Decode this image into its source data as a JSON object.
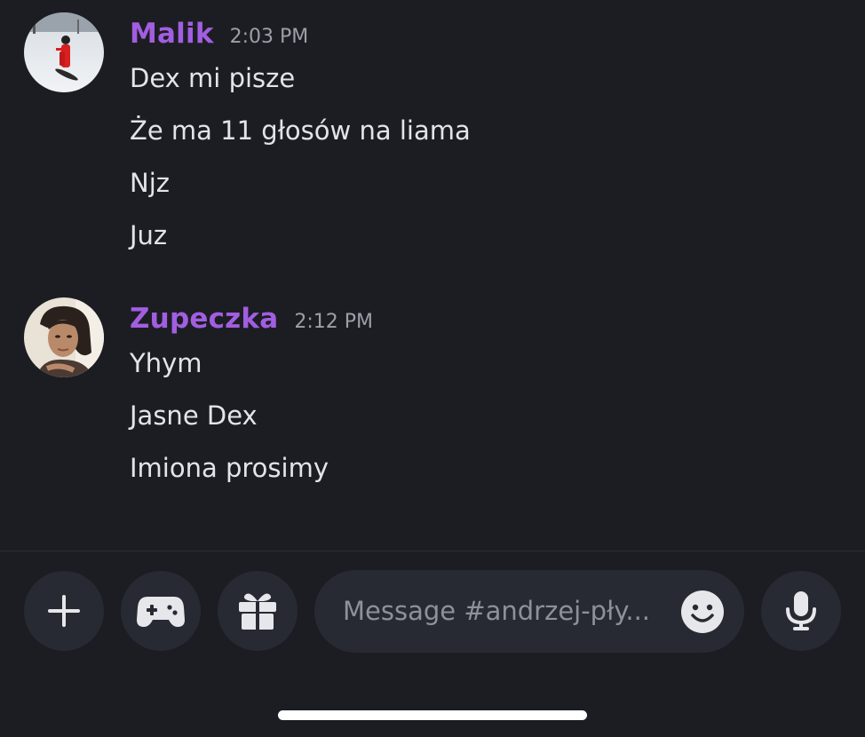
{
  "messages": [
    {
      "author": "Malik",
      "time": "2:03 PM",
      "lines": [
        "Dex mi pisze",
        "Że ma 11 głosów na liama",
        "Njz",
        "Juz"
      ]
    },
    {
      "author": "Zupeczka",
      "time": "2:12 PM",
      "lines": [
        "Yhym",
        "Jasne Dex",
        "Imiona prosimy"
      ]
    }
  ],
  "composer": {
    "placeholder": "Message #andrzej-pły...",
    "buttons": [
      "plus-icon",
      "gamepad-icon",
      "gift-icon",
      "microphone-icon"
    ],
    "emoji_icon": "emoji-icon"
  },
  "colors": {
    "background": "#1c1d23",
    "author": "#a25ee0",
    "button": "#282a33"
  }
}
